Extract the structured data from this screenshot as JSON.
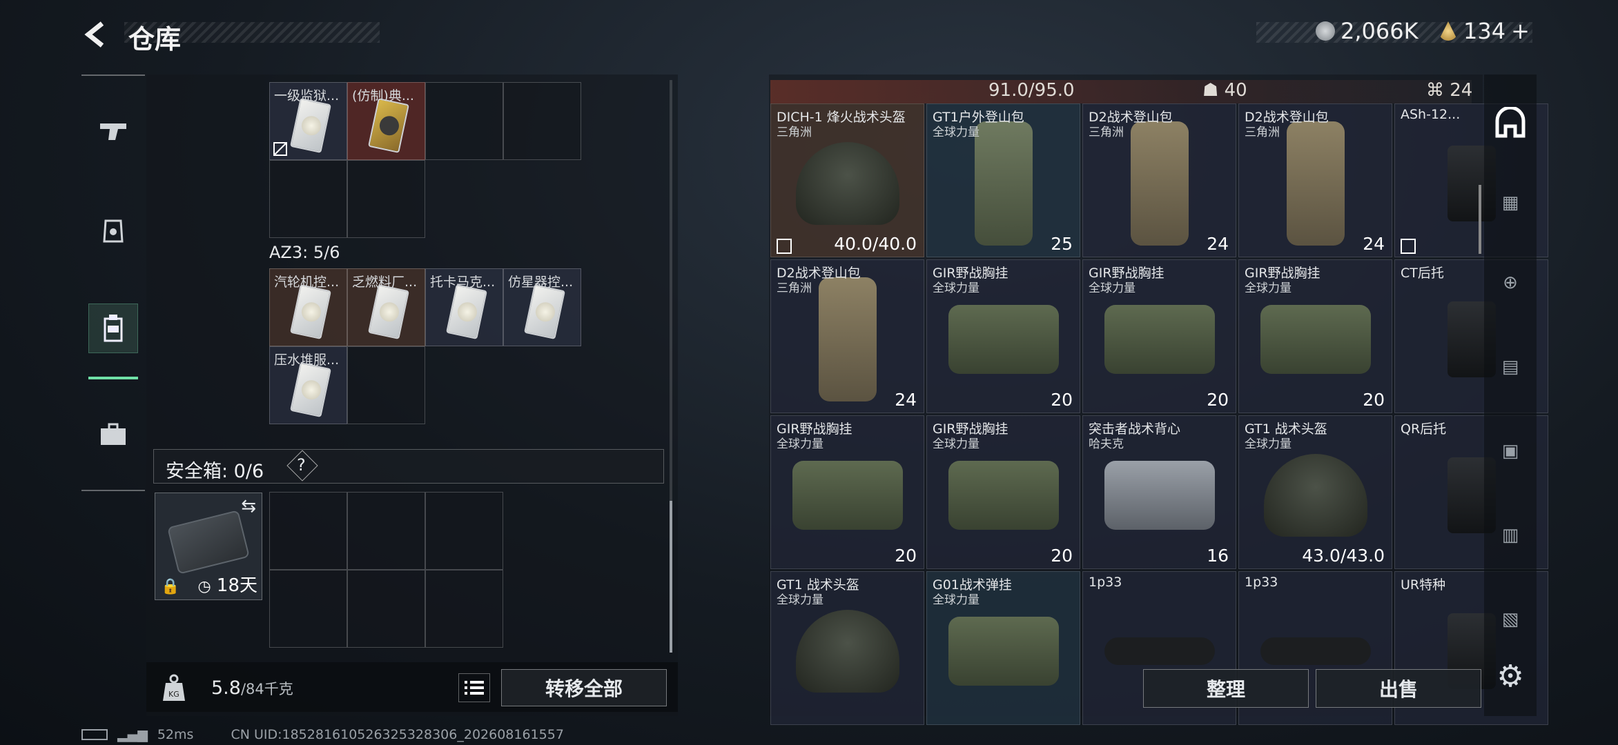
{
  "header": {
    "title": "仓库",
    "currency_a": "2,066K",
    "currency_b": "134",
    "add_label": "+"
  },
  "left_panel": {
    "top_cells": [
      {
        "label": "一级监狱...",
        "color": "blue"
      },
      {
        "label": "(仿制)典...",
        "color": "red"
      }
    ],
    "az3_label": "AZ3: 5/6",
    "az3_cells": [
      {
        "label": "汽轮机控..."
      },
      {
        "label": "乏燃料厂..."
      },
      {
        "label": "托卡马克..."
      },
      {
        "label": "仿星器控..."
      },
      {
        "label": "压水堆服..."
      }
    ],
    "safe_label": "安全箱: 0/6",
    "safe_help": "?",
    "safe_days": "18天",
    "weight_value": "5.8",
    "weight_max": "/84千克",
    "transfer_all": "转移全部"
  },
  "right_panel": {
    "strip": {
      "left": "91.0/95.0",
      "mid": "40",
      "right": "24"
    },
    "items": [
      {
        "name": "DICH-1 烽火战术头盔",
        "sub": "三角洲",
        "stat": "40.0/40.0",
        "kind": "helmet",
        "color": "brown",
        "flag": true
      },
      {
        "name": "GT1户外登山包",
        "sub": "全球力量",
        "stat": "25",
        "kind": "backpack",
        "color": "teal"
      },
      {
        "name": "D2战术登山包",
        "sub": "三角洲",
        "stat": "24",
        "kind": "backpack",
        "color": "blue"
      },
      {
        "name": "D2战术登山包",
        "sub": "三角洲",
        "stat": "24",
        "kind": "backpack",
        "color": "blue"
      },
      {
        "name": "ASh-12...",
        "sub": "",
        "stat": "",
        "kind": "stock",
        "color": "blue",
        "flag": true
      },
      {
        "name": "D2战术登山包",
        "sub": "三角洲",
        "stat": "24",
        "kind": "backpack",
        "color": "blue"
      },
      {
        "name": "GIR野战胸挂",
        "sub": "全球力量",
        "stat": "20",
        "kind": "chest",
        "color": "blue"
      },
      {
        "name": "GIR野战胸挂",
        "sub": "全球力量",
        "stat": "20",
        "kind": "chest",
        "color": "blue"
      },
      {
        "name": "GIR野战胸挂",
        "sub": "全球力量",
        "stat": "20",
        "kind": "chest",
        "color": "blue"
      },
      {
        "name": "CT后托",
        "sub": "",
        "stat": "",
        "kind": "stock",
        "color": "blue"
      },
      {
        "name": "GIR野战胸挂",
        "sub": "全球力量",
        "stat": "20",
        "kind": "chest",
        "color": "blue"
      },
      {
        "name": "GIR野战胸挂",
        "sub": "全球力量",
        "stat": "20",
        "kind": "chest",
        "color": "blue"
      },
      {
        "name": "突击者战术背心",
        "sub": "哈夫克",
        "stat": "16",
        "kind": "chest",
        "color": "blue"
      },
      {
        "name": "GT1 战术头盔",
        "sub": "全球力量",
        "stat": "43.0/43.0",
        "kind": "helmet",
        "color": "blue"
      },
      {
        "name": "QR后托",
        "sub": "",
        "stat": "",
        "kind": "stock",
        "color": "blue"
      },
      {
        "name": "GT1 战术头盔",
        "sub": "全球力量",
        "stat": "",
        "kind": "helmet",
        "color": "blue"
      },
      {
        "name": "G01战术弹挂",
        "sub": "全球力量",
        "stat": "",
        "kind": "chest",
        "color": "teal"
      },
      {
        "name": "1p33",
        "sub": "",
        "stat": "",
        "kind": "scope",
        "color": "blue"
      },
      {
        "name": "1p33",
        "sub": "",
        "stat": "",
        "kind": "scope",
        "color": "blue"
      },
      {
        "name": "UR特种",
        "sub": "",
        "stat": "",
        "kind": "stock",
        "color": "blue"
      }
    ],
    "sort": "整理",
    "sell": "出售"
  },
  "status": {
    "ping": "52ms",
    "uid": "CN UID:18528161052632532830​6_202608161557"
  }
}
